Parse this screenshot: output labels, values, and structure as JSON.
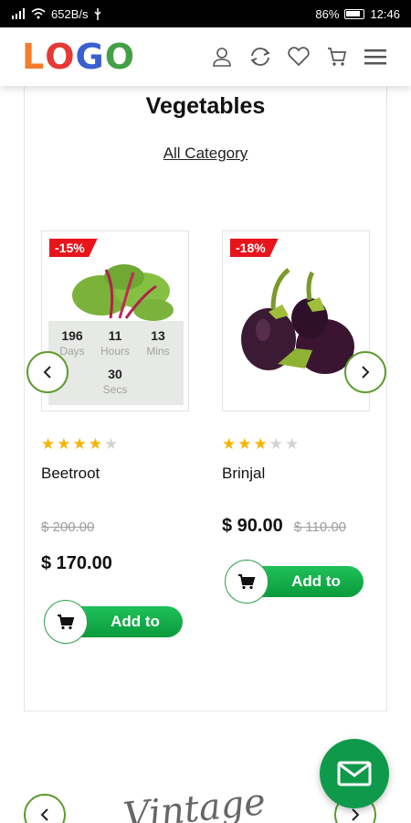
{
  "status": {
    "network": "652B/s",
    "battery": "86%",
    "time": "12:46"
  },
  "header": {
    "logo": [
      "L",
      "O",
      "G",
      "O"
    ]
  },
  "section": {
    "title": "Vegetables",
    "category_link": "All Category"
  },
  "products": [
    {
      "badge": "-15%",
      "name": "Beetroot",
      "rating": 4,
      "old_price": "$ 200.00",
      "price": "$ 170.00",
      "add_label": "Add to",
      "countdown": {
        "days": "196",
        "days_label": "Days",
        "hours": "11",
        "hours_label": "Hours",
        "mins": "13",
        "mins_label": "Mins",
        "secs": "30",
        "secs_label": "Secs"
      }
    },
    {
      "badge": "-18%",
      "name": "Brinjal",
      "rating": 3,
      "price": "$ 90.00",
      "old_price": "$ 110.00",
      "add_label": "Add to"
    }
  ],
  "next_section": {
    "heading_partial": "Vintage"
  },
  "colors": {
    "accent_green": "#0f9a4b",
    "badge_red": "#e8141b",
    "star": "#f5b400"
  }
}
